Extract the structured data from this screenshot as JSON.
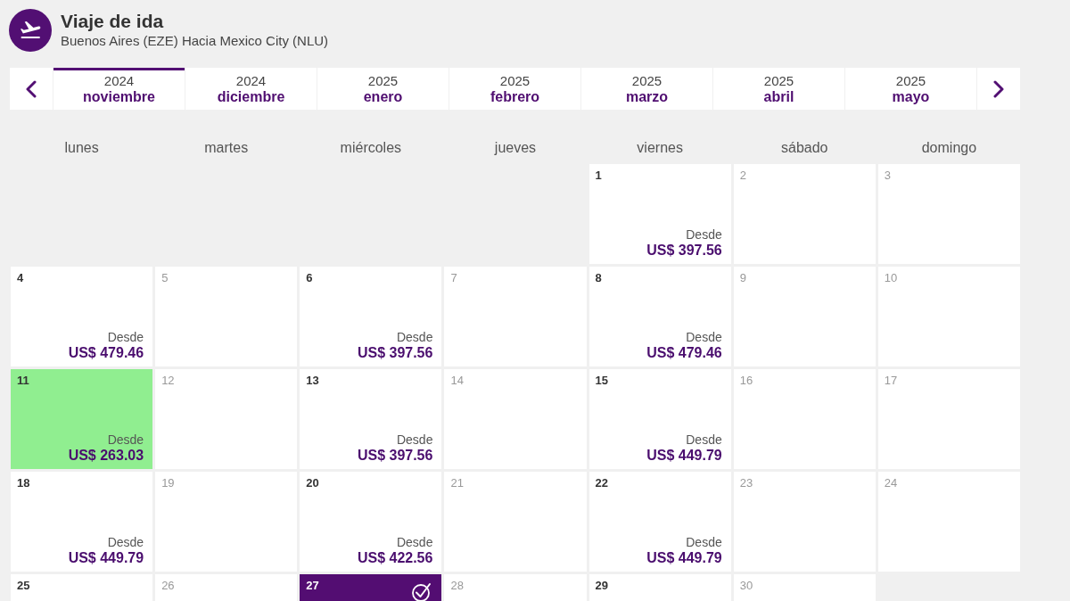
{
  "header": {
    "title": "Viaje de ida",
    "subtitle": "Buenos Aires (EZE) Hacia Mexico City (NLU)"
  },
  "months": [
    {
      "year": "2024",
      "month": "noviembre",
      "selected": true
    },
    {
      "year": "2024",
      "month": "diciembre",
      "selected": false
    },
    {
      "year": "2025",
      "month": "enero",
      "selected": false
    },
    {
      "year": "2025",
      "month": "febrero",
      "selected": false
    },
    {
      "year": "2025",
      "month": "marzo",
      "selected": false
    },
    {
      "year": "2025",
      "month": "abril",
      "selected": false
    },
    {
      "year": "2025",
      "month": "mayo",
      "selected": false
    }
  ],
  "weekdays": [
    "lunes",
    "martes",
    "miércoles",
    "jueves",
    "viernes",
    "sábado",
    "domingo"
  ],
  "weeks": [
    {
      "days": [
        {
          "kind": "blank"
        },
        {
          "kind": "blank"
        },
        {
          "kind": "blank"
        },
        {
          "kind": "blank"
        },
        {
          "kind": "day",
          "day": "1",
          "available": true,
          "selected": false,
          "cheapest": false,
          "from_label": "Desde",
          "price": "US$ 397.56"
        },
        {
          "kind": "day",
          "day": "2",
          "available": false,
          "selected": false,
          "cheapest": false
        },
        {
          "kind": "day",
          "day": "3",
          "available": false,
          "selected": false,
          "cheapest": false
        }
      ]
    },
    {
      "days": [
        {
          "kind": "day",
          "day": "4",
          "available": true,
          "selected": false,
          "cheapest": false,
          "from_label": "Desde",
          "price": "US$ 479.46"
        },
        {
          "kind": "day",
          "day": "5",
          "available": false,
          "selected": false,
          "cheapest": false
        },
        {
          "kind": "day",
          "day": "6",
          "available": true,
          "selected": false,
          "cheapest": false,
          "from_label": "Desde",
          "price": "US$ 397.56"
        },
        {
          "kind": "day",
          "day": "7",
          "available": false,
          "selected": false,
          "cheapest": false
        },
        {
          "kind": "day",
          "day": "8",
          "available": true,
          "selected": false,
          "cheapest": false,
          "from_label": "Desde",
          "price": "US$ 479.46"
        },
        {
          "kind": "day",
          "day": "9",
          "available": false,
          "selected": false,
          "cheapest": false
        },
        {
          "kind": "day",
          "day": "10",
          "available": false,
          "selected": false,
          "cheapest": false
        }
      ]
    },
    {
      "days": [
        {
          "kind": "day",
          "day": "11",
          "available": true,
          "selected": false,
          "cheapest": true,
          "from_label": "Desde",
          "price": "US$ 263.03"
        },
        {
          "kind": "day",
          "day": "12",
          "available": false,
          "selected": false,
          "cheapest": false
        },
        {
          "kind": "day",
          "day": "13",
          "available": true,
          "selected": false,
          "cheapest": false,
          "from_label": "Desde",
          "price": "US$ 397.56"
        },
        {
          "kind": "day",
          "day": "14",
          "available": false,
          "selected": false,
          "cheapest": false
        },
        {
          "kind": "day",
          "day": "15",
          "available": true,
          "selected": false,
          "cheapest": false,
          "from_label": "Desde",
          "price": "US$ 449.79"
        },
        {
          "kind": "day",
          "day": "16",
          "available": false,
          "selected": false,
          "cheapest": false
        },
        {
          "kind": "day",
          "day": "17",
          "available": false,
          "selected": false,
          "cheapest": false
        }
      ]
    },
    {
      "days": [
        {
          "kind": "day",
          "day": "18",
          "available": true,
          "selected": false,
          "cheapest": false,
          "from_label": "Desde",
          "price": "US$ 449.79"
        },
        {
          "kind": "day",
          "day": "19",
          "available": false,
          "selected": false,
          "cheapest": false
        },
        {
          "kind": "day",
          "day": "20",
          "available": true,
          "selected": false,
          "cheapest": false,
          "from_label": "Desde",
          "price": "US$ 422.56"
        },
        {
          "kind": "day",
          "day": "21",
          "available": false,
          "selected": false,
          "cheapest": false
        },
        {
          "kind": "day",
          "day": "22",
          "available": true,
          "selected": false,
          "cheapest": false,
          "from_label": "Desde",
          "price": "US$ 449.79"
        },
        {
          "kind": "day",
          "day": "23",
          "available": false,
          "selected": false,
          "cheapest": false
        },
        {
          "kind": "day",
          "day": "24",
          "available": false,
          "selected": false,
          "cheapest": false
        }
      ]
    },
    {
      "days": [
        {
          "kind": "day",
          "day": "25",
          "available": true,
          "selected": false,
          "cheapest": false
        },
        {
          "kind": "day",
          "day": "26",
          "available": false,
          "selected": false,
          "cheapest": false
        },
        {
          "kind": "day",
          "day": "27",
          "available": true,
          "selected": true,
          "cheapest": false
        },
        {
          "kind": "day",
          "day": "28",
          "available": false,
          "selected": false,
          "cheapest": false
        },
        {
          "kind": "day",
          "day": "29",
          "available": true,
          "selected": false,
          "cheapest": false
        },
        {
          "kind": "day",
          "day": "30",
          "available": false,
          "selected": false,
          "cheapest": false
        },
        {
          "kind": "blank"
        }
      ]
    }
  ]
}
